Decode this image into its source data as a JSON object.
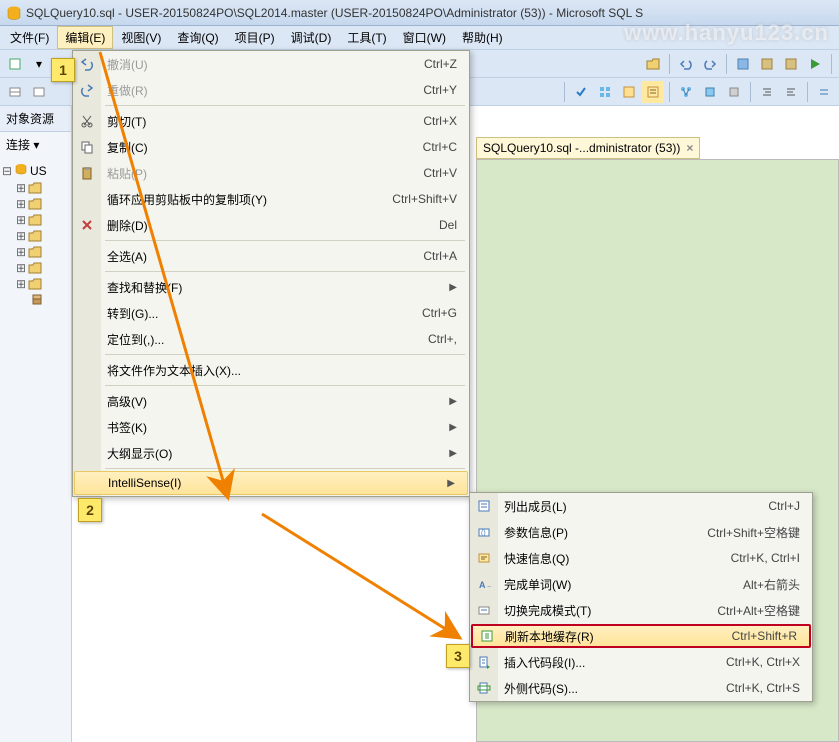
{
  "title": "SQLQuery10.sql - USER-20150824PO\\SQL2014.master (USER-20150824PO\\Administrator (53)) - Microsoft SQL S",
  "watermark": "www.hanyu123.cn",
  "menubar": [
    {
      "label": "文件(F)"
    },
    {
      "label": "编辑(E)"
    },
    {
      "label": "视图(V)"
    },
    {
      "label": "查询(Q)"
    },
    {
      "label": "项目(P)"
    },
    {
      "label": "调试(D)"
    },
    {
      "label": "工具(T)"
    },
    {
      "label": "窗口(W)"
    },
    {
      "label": "帮助(H)"
    }
  ],
  "sidebar": {
    "title": "对象资源",
    "connect": "连接 ▾",
    "root": "US"
  },
  "doc_tab": {
    "label": "SQLQuery10.sql -...dministrator (53))"
  },
  "edit_menu": [
    {
      "icon": "undo-icon",
      "label": "撤消(U)",
      "shortcut": "Ctrl+Z",
      "disabled": true
    },
    {
      "icon": "redo-icon",
      "label": "重做(R)",
      "shortcut": "Ctrl+Y",
      "disabled": true
    },
    {
      "sep": true
    },
    {
      "icon": "cut-icon",
      "label": "剪切(T)",
      "shortcut": "Ctrl+X"
    },
    {
      "icon": "copy-icon",
      "label": "复制(C)",
      "shortcut": "Ctrl+C"
    },
    {
      "icon": "paste-icon",
      "label": "粘贴(P)",
      "shortcut": "Ctrl+V",
      "disabled": true
    },
    {
      "icon": "",
      "label": "循环应用剪贴板中的复制项(Y)",
      "shortcut": "Ctrl+Shift+V"
    },
    {
      "icon": "delete-icon",
      "label": "删除(D)",
      "shortcut": "Del"
    },
    {
      "sep": true
    },
    {
      "icon": "",
      "label": "全选(A)",
      "shortcut": "Ctrl+A"
    },
    {
      "sep": true
    },
    {
      "icon": "",
      "label": "查找和替换(F)",
      "submenu": true
    },
    {
      "icon": "",
      "label": "转到(G)...",
      "shortcut": "Ctrl+G"
    },
    {
      "icon": "",
      "label": "定位到(,)...",
      "shortcut": "Ctrl+,"
    },
    {
      "sep": true
    },
    {
      "icon": "",
      "label": "将文件作为文本插入(X)..."
    },
    {
      "sep": true
    },
    {
      "icon": "",
      "label": "高级(V)",
      "submenu": true
    },
    {
      "icon": "",
      "label": "书签(K)",
      "submenu": true
    },
    {
      "icon": "",
      "label": "大纲显示(O)",
      "submenu": true
    },
    {
      "sep": true
    },
    {
      "icon": "",
      "label": "IntelliSense(I)",
      "submenu": true,
      "highlighted": true
    }
  ],
  "intellisense_menu": [
    {
      "icon": "list-members-icon",
      "label": "列出成员(L)",
      "shortcut": "Ctrl+J"
    },
    {
      "icon": "param-info-icon",
      "label": "参数信息(P)",
      "shortcut": "Ctrl+Shift+空格键"
    },
    {
      "icon": "quick-info-icon",
      "label": "快速信息(Q)",
      "shortcut": "Ctrl+K, Ctrl+I"
    },
    {
      "icon": "complete-word-icon",
      "label": "完成单词(W)",
      "shortcut": "Alt+右箭头"
    },
    {
      "icon": "toggle-mode-icon",
      "label": "切换完成模式(T)",
      "shortcut": "Ctrl+Alt+空格键"
    },
    {
      "icon": "refresh-cache-icon",
      "label": "刷新本地缓存(R)",
      "shortcut": "Ctrl+Shift+R",
      "redbox": true
    },
    {
      "icon": "insert-snippet-icon",
      "label": "插入代码段(I)...",
      "shortcut": "Ctrl+K, Ctrl+X"
    },
    {
      "icon": "surround-icon",
      "label": "外侧代码(S)...",
      "shortcut": "Ctrl+K, Ctrl+S"
    }
  ],
  "callouts": {
    "one": "1",
    "two": "2",
    "three": "3"
  }
}
